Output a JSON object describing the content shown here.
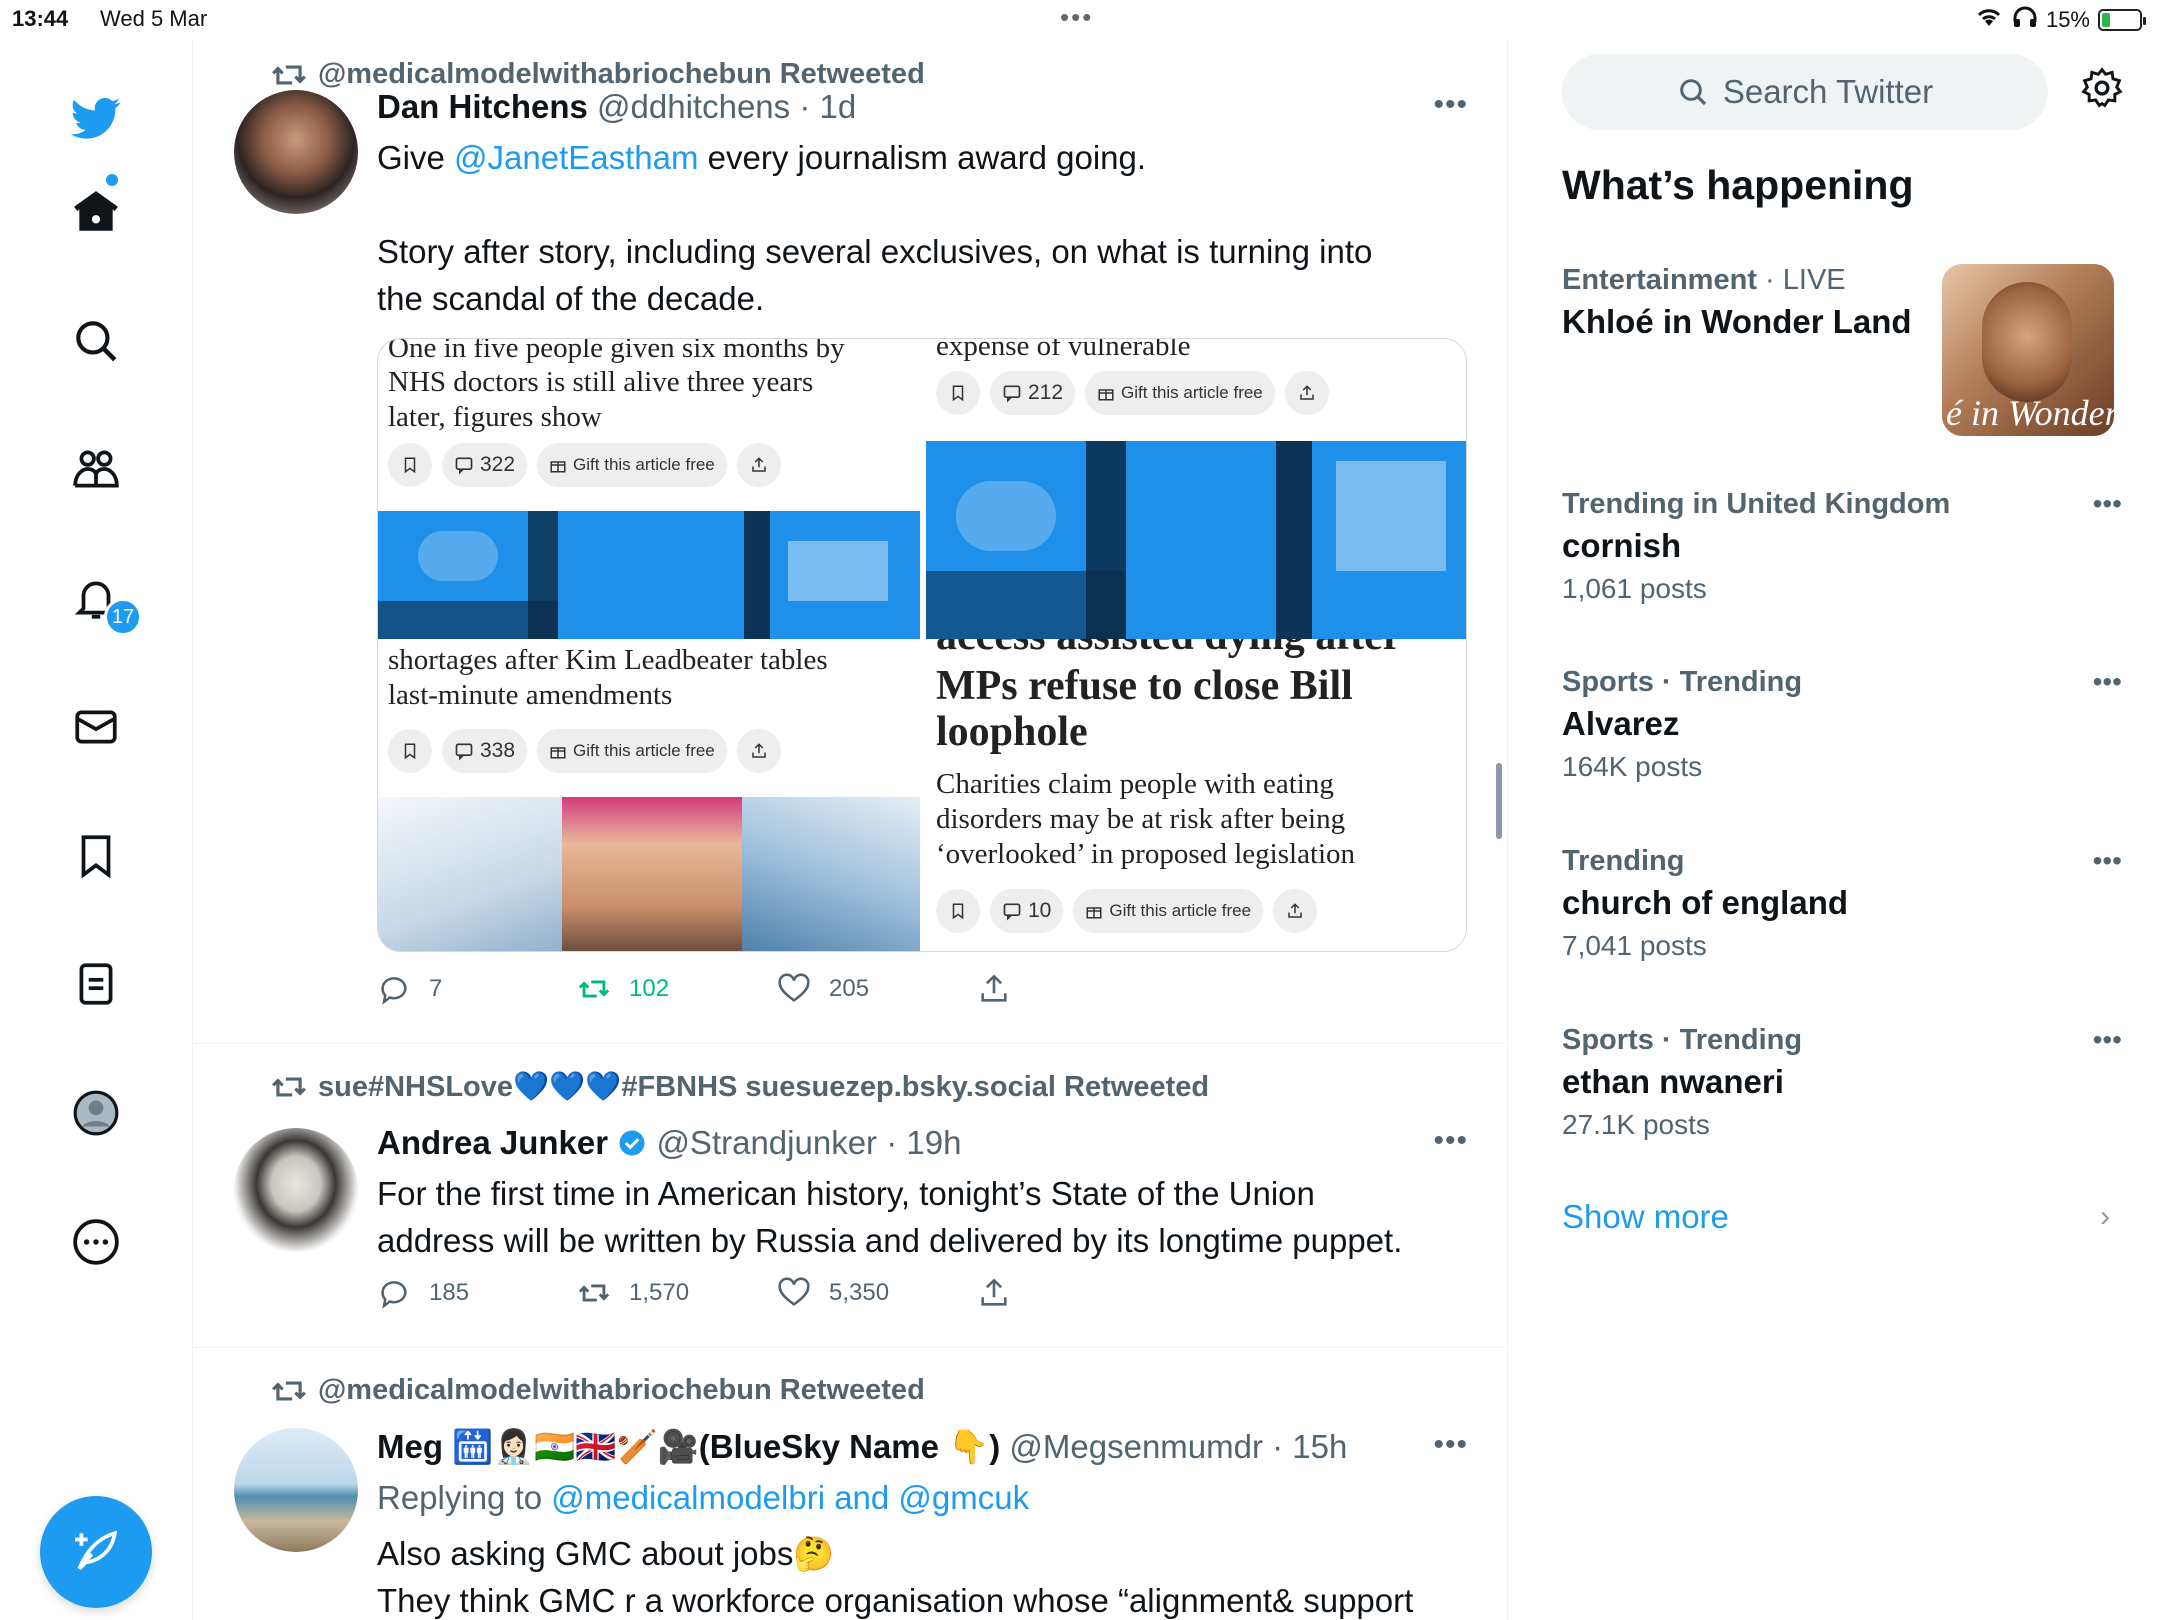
{
  "status_bar": {
    "time": "13:44",
    "date": "Wed 5 Mar",
    "battery": "15%"
  },
  "nav": {
    "notifications_badge": "17"
  },
  "tweets": [
    {
      "retweeted_by": "@medicalmodelwithabriochebun Retweeted",
      "name": "Dan Hitchens",
      "handle": "@ddhitchens",
      "time": "· 1d",
      "text_before": "Give ",
      "mention": "@JanetEastham",
      "text_after": " every journalism award going.",
      "text_para2_line1": "Story after story, including several exclusives, on what is turning into",
      "text_para2_line2": "the scandal of the decade.",
      "media": {
        "a_text_1": "One in five people given six months by",
        "a_text_2": "NHS doctors is still alive three years",
        "a_text_3": "later, figures show",
        "a_comments": "322",
        "gift_label": "Gift this article free",
        "b_text_1": "expense of vulnerable",
        "b_comments": "212",
        "c_text_1": "shortages after Kim Leadbeater tables",
        "c_text_2": "last-minute amendments",
        "c_comments": "338",
        "d_text_cut": "access assisted dying after",
        "d_head_1": "MPs refuse to close Bill",
        "d_head_2": "loophole",
        "d_text_1": "Charities claim people with eating",
        "d_text_2": "disorders may be at risk after being",
        "d_text_3": "‘overlooked’ in proposed legislation",
        "d_comments": "10"
      },
      "replies": "7",
      "retweets": "102",
      "likes": "205"
    },
    {
      "retweeted_by": "sue#NHSLove💙💙💙#FBNHS suesuezep.bsky.social Retweeted",
      "name": "Andrea Junker",
      "handle": "@Strandjunker",
      "time": "· 19h",
      "text_line1": "For the first time in American history, tonight’s State of the Union",
      "text_line2": "address will be written by Russia and delivered by its longtime puppet.",
      "replies": "185",
      "retweets": "1,570",
      "likes": "5,350"
    },
    {
      "retweeted_by": "@medicalmodelwithabriochebun Retweeted",
      "name": "Meg 🛗👩🏻‍⚕️🇮🇳🇬🇧🏏🎥(BlueSky Name 👇)",
      "handle": "@Megsenmumdr",
      "time": "· 15h",
      "replying_label": "Replying to ",
      "replying_to": "@medicalmodelbri and @gmcuk",
      "text_line1": "Also asking GMC about jobs🤔",
      "text_line2": "They think GMC r a workforce organisation whose “alignment& support"
    }
  ],
  "sidebar": {
    "search_placeholder": "Search Twitter",
    "whats_happening": "What’s happening",
    "trends": [
      {
        "context": "Entertainment",
        "context_extra": " · LIVE",
        "topic": "Khloé in Wonder Land",
        "count": ""
      },
      {
        "context": "Trending in United Kingdom",
        "context_extra": "",
        "topic": "cornish",
        "count": "1,061 posts"
      },
      {
        "context": "Sports · Trending",
        "context_extra": "",
        "topic": "Alvarez",
        "count": "164K posts"
      },
      {
        "context": "Trending",
        "context_extra": "",
        "topic": "church of england",
        "count": "7,041 posts"
      },
      {
        "context": "Sports · Trending",
        "context_extra": "",
        "topic": "ethan nwaneri",
        "count": "27.1K posts"
      }
    ],
    "trend_image_caption": "é in Wonder L",
    "show_more": "Show more"
  },
  "colors": {
    "accent": "#1d9bf0",
    "retweet_active": "#00ba7c",
    "secondary_text": "#536471"
  }
}
